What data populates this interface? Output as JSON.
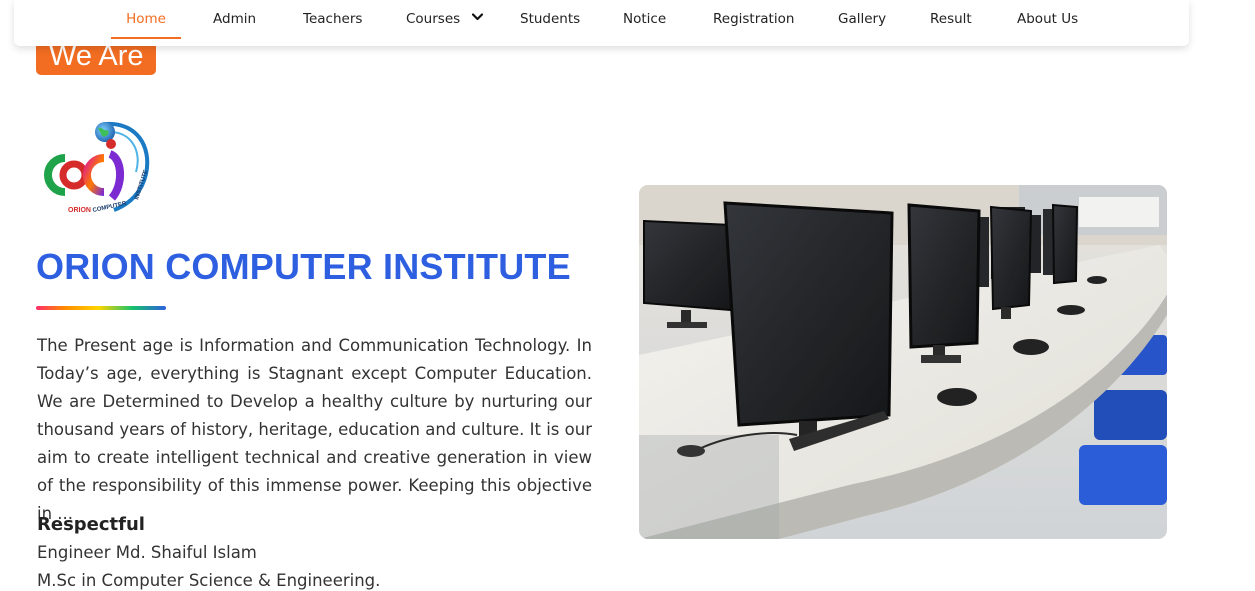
{
  "nav": {
    "items": [
      {
        "label": "Home",
        "active": true
      },
      {
        "label": "Admin"
      },
      {
        "label": "Teachers"
      },
      {
        "label": "Courses",
        "icon": "chevron-down-icon"
      },
      {
        "label": "Students"
      },
      {
        "label": "Notice"
      },
      {
        "label": "Registration"
      },
      {
        "label": "Gallery"
      },
      {
        "label": "Result"
      },
      {
        "label": "About Us"
      }
    ]
  },
  "badge": {
    "label": "We Are"
  },
  "logo": {
    "text": "ORION COMPUTER INSTITUTE"
  },
  "about": {
    "title": "ORION COMPUTER INSTITUTE",
    "description": "The Present age is Information and Communication Technology. In Today’s age, everything is Stagnant except Computer Education. We are Determined to Develop a healthy culture by nurturing our thousand years of history, heritage, education and culture. It is our aim to create intelligent technical and creative generation in view of the responsibility of this immense power. Keeping this objective in ...",
    "signature": {
      "title": "Respectful",
      "name": "Engineer Md. Shaiful Islam",
      "degree": "M.Sc in Computer Science & Engineering."
    }
  },
  "colors": {
    "accent": "#f26d21",
    "title": "#2d5fe0"
  }
}
